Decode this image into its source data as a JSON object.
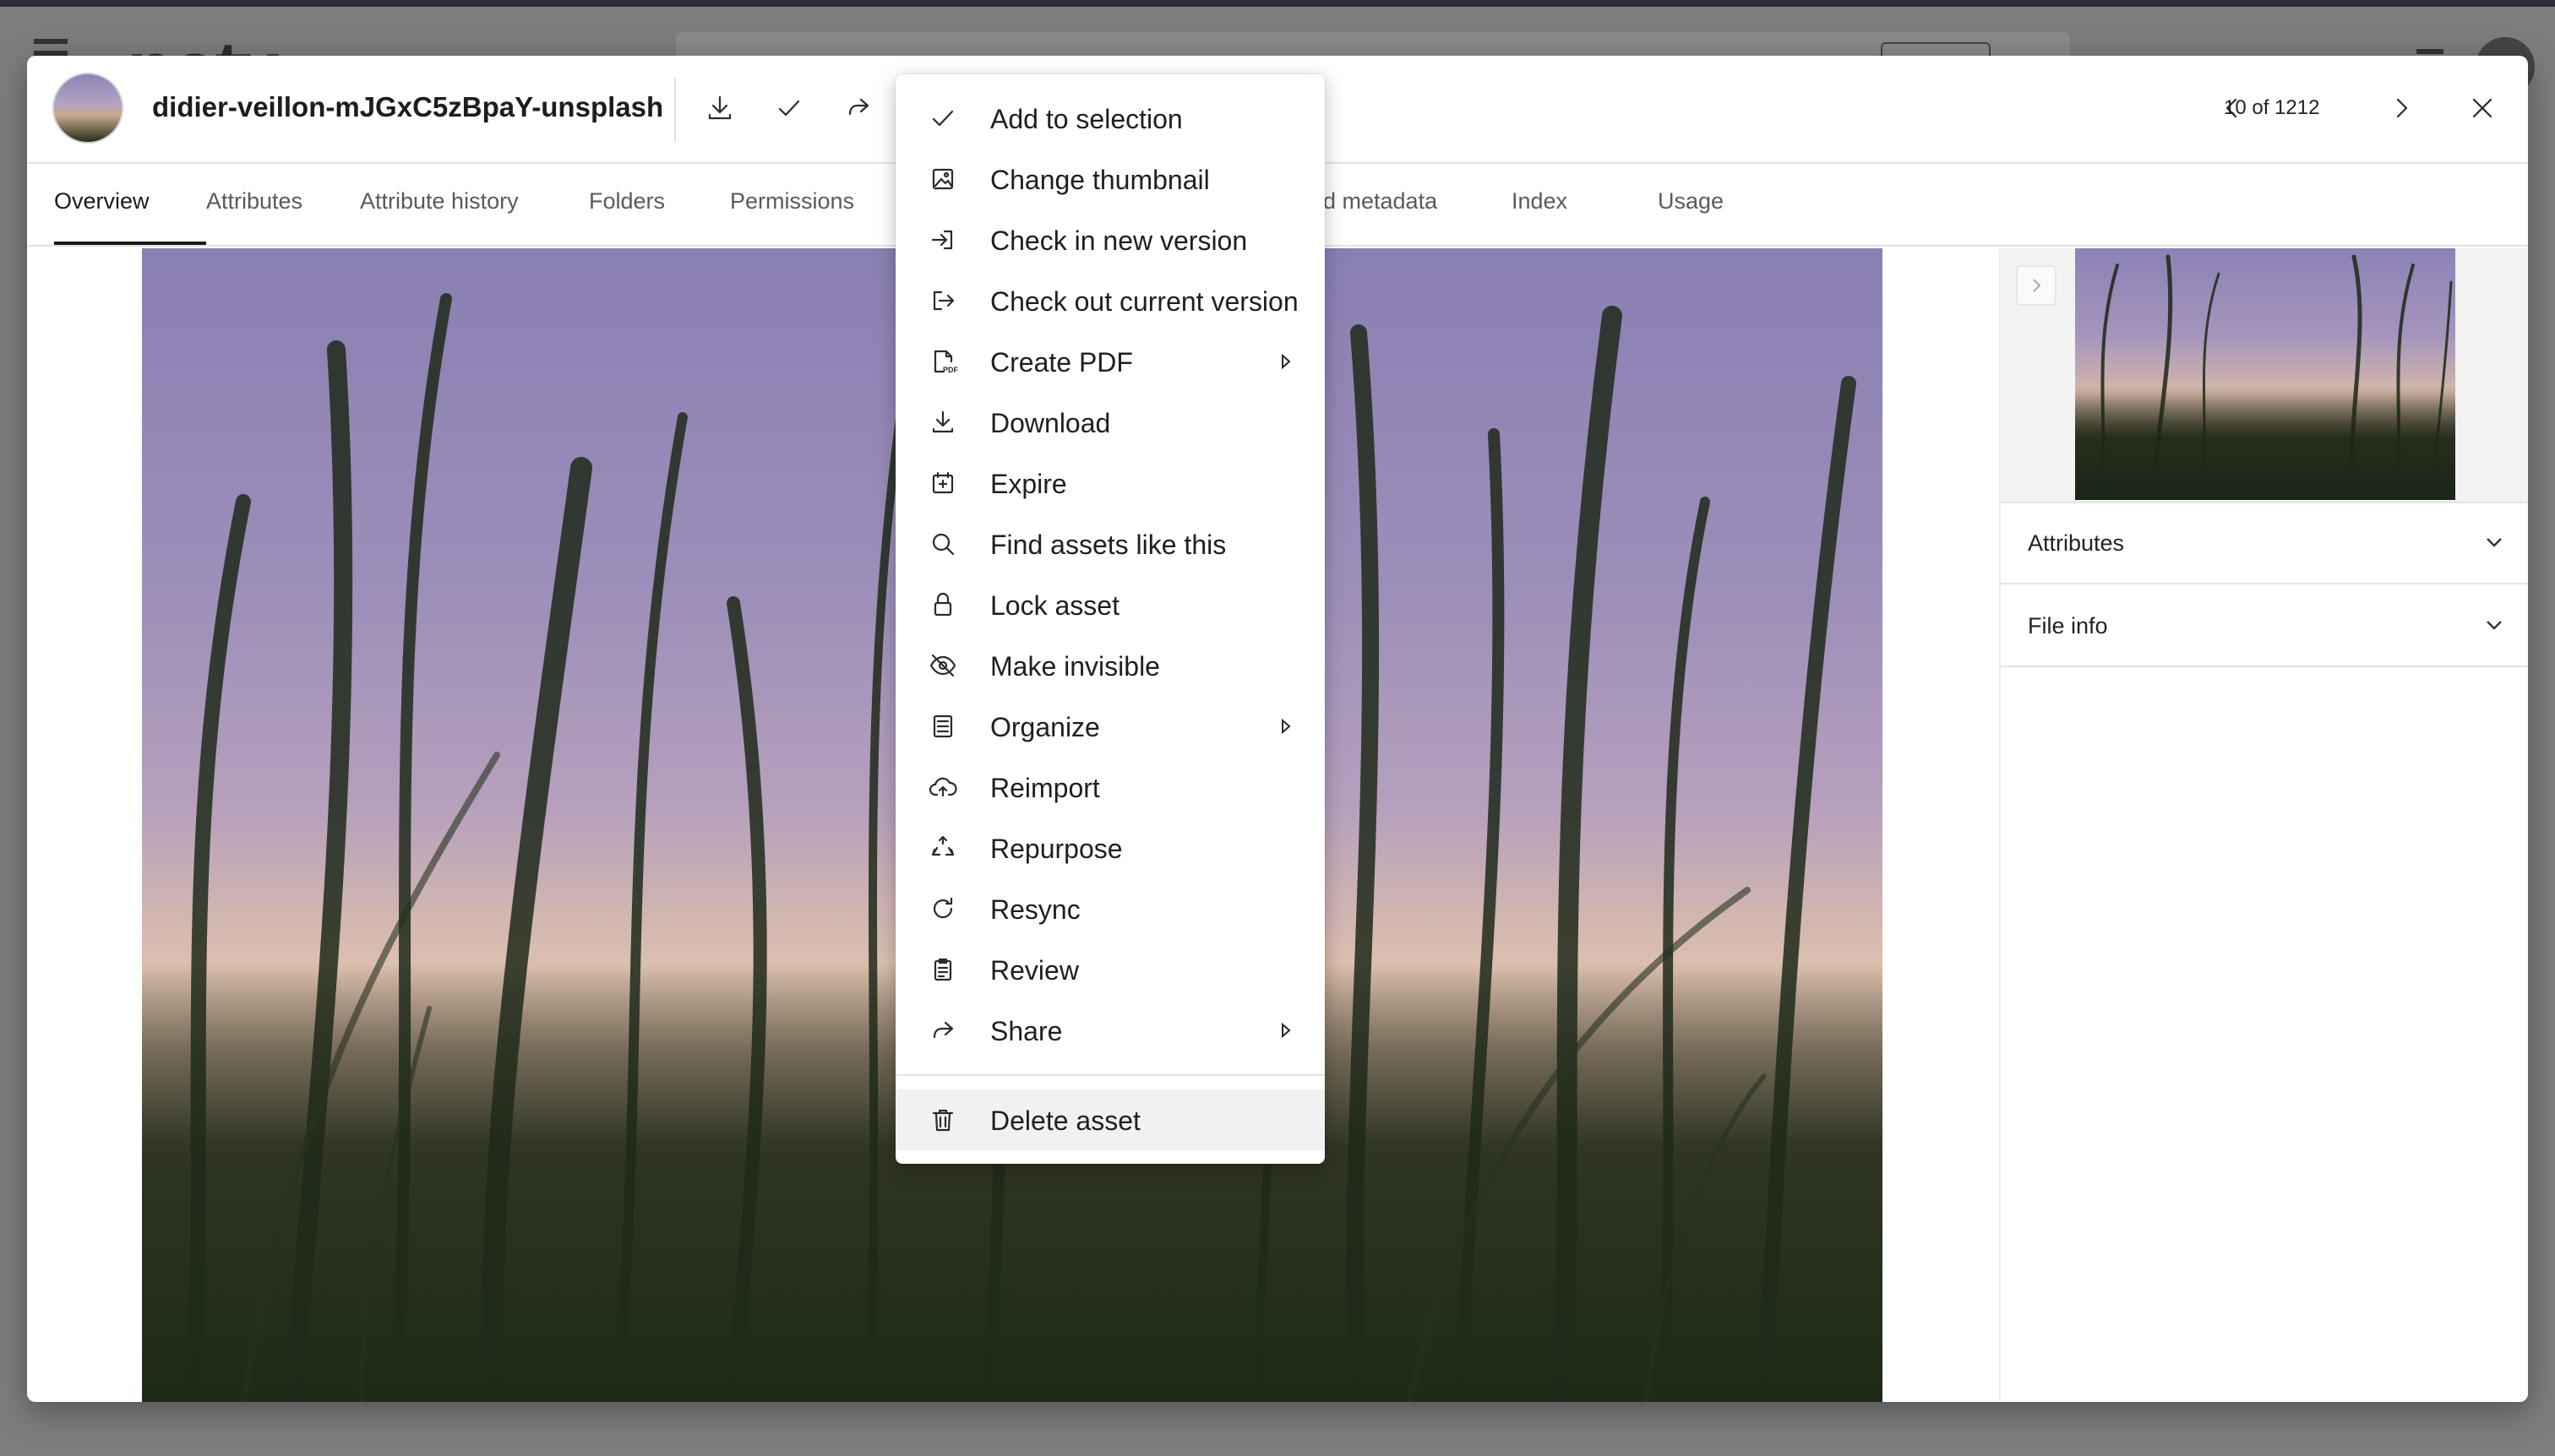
{
  "asset": {
    "title": "didier-veillon-mJGxC5zBpaY-unsplash",
    "pager": "10 of 1212"
  },
  "backdrop": {
    "logo": "notx"
  },
  "tabs": [
    {
      "label": "Overview",
      "active": true
    },
    {
      "label": "Attributes"
    },
    {
      "label": "Attribute history"
    },
    {
      "label": "Folders"
    },
    {
      "label": "Permissions"
    },
    {
      "label": "d metadata"
    },
    {
      "label": "Index"
    },
    {
      "label": "Usage"
    }
  ],
  "sidebar": {
    "sections": [
      {
        "label": "Attributes"
      },
      {
        "label": "File info"
      }
    ]
  },
  "menu": {
    "items": [
      {
        "label": "Add to selection",
        "icon": "check-icon"
      },
      {
        "label": "Change thumbnail",
        "icon": "image-icon"
      },
      {
        "label": "Check in new version",
        "icon": "check-in-icon"
      },
      {
        "label": "Check out current version",
        "icon": "check-out-icon"
      },
      {
        "label": "Create PDF",
        "icon": "pdf-icon",
        "submenu": true
      },
      {
        "label": "Download",
        "icon": "download-icon"
      },
      {
        "label": "Expire",
        "icon": "calendar-plus-icon"
      },
      {
        "label": "Find assets like this",
        "icon": "search-icon"
      },
      {
        "label": "Lock asset",
        "icon": "lock-icon"
      },
      {
        "label": "Make invisible",
        "icon": "eye-off-icon"
      },
      {
        "label": "Organize",
        "icon": "list-icon",
        "submenu": true
      },
      {
        "label": "Reimport",
        "icon": "cloud-upload-icon"
      },
      {
        "label": "Repurpose",
        "icon": "recycle-icon"
      },
      {
        "label": "Resync",
        "icon": "refresh-icon"
      },
      {
        "label": "Review",
        "icon": "clipboard-icon"
      },
      {
        "label": "Share",
        "icon": "share-icon",
        "submenu": true
      }
    ],
    "delete": {
      "label": "Delete asset",
      "icon": "trash-icon"
    }
  }
}
